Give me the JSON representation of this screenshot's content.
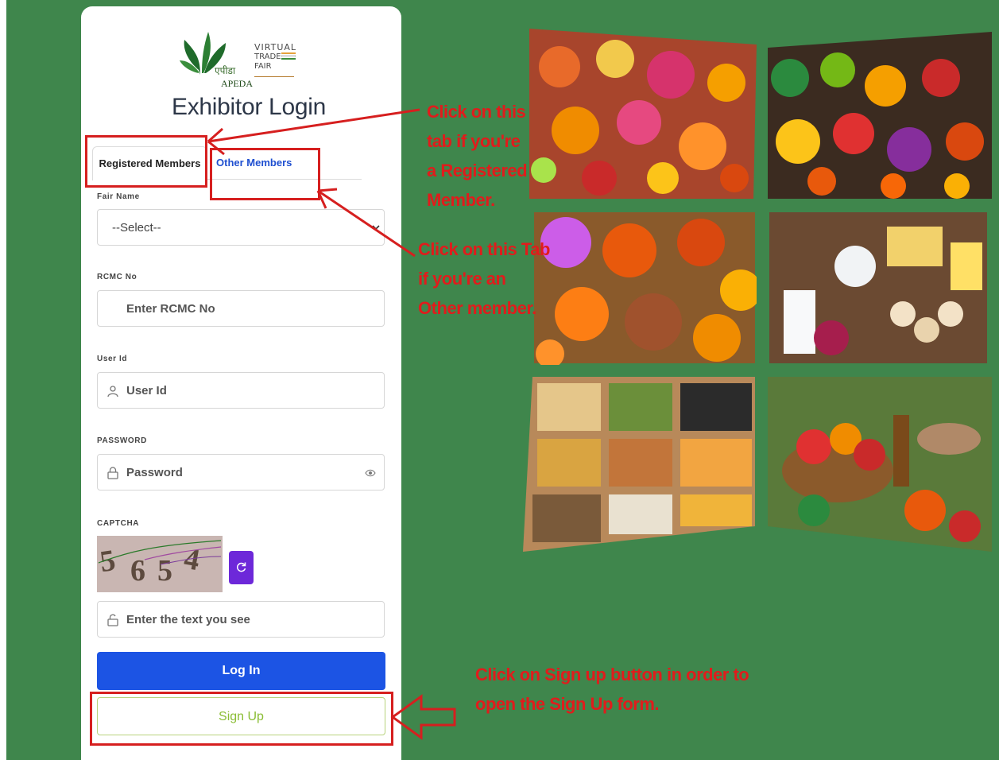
{
  "logo": {
    "hindi_text": "एपीडा",
    "english_text": "APEDA",
    "vtf_line1": "VIRTUAL",
    "vtf_line2": "TRADE",
    "vtf_line3": "FAIR"
  },
  "page_title": "Exhibitor Login",
  "tabs": [
    {
      "label": "Registered Members",
      "active": true
    },
    {
      "label": "Other Members",
      "active": false
    }
  ],
  "form": {
    "fair_name_label": "Fair Name",
    "fair_name_selected": "--Select--",
    "rcmc_label": "RCMC No",
    "rcmc_placeholder": "Enter RCMC No",
    "userid_label": "User Id",
    "userid_placeholder": "User Id",
    "password_label": "PASSWORD",
    "password_placeholder": "Password",
    "captcha_label": "CAPTCHA",
    "captcha_chars": [
      "5",
      "6",
      "5",
      "4"
    ],
    "captcha_placeholder": "Enter the text you see",
    "login_label": "Log In",
    "signup_label": "Sign Up"
  },
  "annotations": {
    "registered": [
      "Click on this",
      "tab if you're",
      "a Registered",
      "Member."
    ],
    "other": [
      "Click on this Tab",
      "if you're  an",
      "Other member."
    ],
    "signup": [
      "Click on Sign up button  in order to",
      "open the Sign Up form."
    ]
  },
  "colors": {
    "background": "#3f864c",
    "accent_blue": "#1c54e4",
    "captcha_refresh": "#6d28d9",
    "signup_text": "#8bbd35",
    "annotation_red": "#e01c1c"
  }
}
